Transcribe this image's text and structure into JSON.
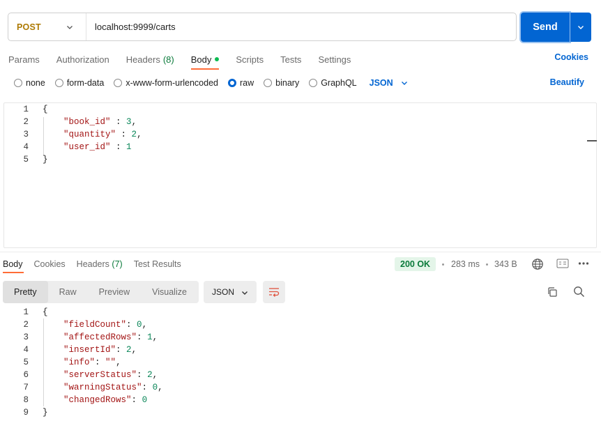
{
  "request": {
    "method": "POST",
    "url": "localhost:9999/carts",
    "send_label": "Send"
  },
  "request_tabs": [
    {
      "label": "Params"
    },
    {
      "label": "Authorization"
    },
    {
      "label": "Headers",
      "count": "(8)"
    },
    {
      "label": "Body"
    },
    {
      "label": "Scripts"
    },
    {
      "label": "Tests"
    },
    {
      "label": "Settings"
    }
  ],
  "cookies_label": "Cookies",
  "body_types": [
    "none",
    "form-data",
    "x-www-form-urlencoded",
    "raw",
    "binary",
    "GraphQL"
  ],
  "body_format": "JSON",
  "beautify_label": "Beautify",
  "request_body": {
    "line_numbers": [
      "1",
      "2",
      "3",
      "4",
      "5"
    ],
    "open": "{",
    "close": "}",
    "k1": "\"book_id\"",
    "s1": " : ",
    "v1": "3",
    "c1": ",",
    "k2": "\"quantity\"",
    "s2": " : ",
    "v2": "2",
    "c2": ",",
    "k3": "\"user_id\"",
    "s3": " : ",
    "v3": "1"
  },
  "response": {
    "tabs": [
      {
        "label": "Body"
      },
      {
        "label": "Cookies"
      },
      {
        "label": "Headers",
        "count": "(7)"
      },
      {
        "label": "Test Results"
      }
    ],
    "status": "200 OK",
    "time": "283 ms",
    "size": "343 B",
    "views": [
      "Pretty",
      "Raw",
      "Preview",
      "Visualize"
    ],
    "format": "JSON",
    "line_numbers": [
      "1",
      "2",
      "3",
      "4",
      "5",
      "6",
      "7",
      "8",
      "9"
    ],
    "open": "{",
    "close": "}",
    "k1": "\"fieldCount\"",
    "v1": "0",
    "k2": "\"affectedRows\"",
    "v2": "1",
    "k3": "\"insertId\"",
    "v3": "2",
    "k4": "\"info\"",
    "v4": "\"\"",
    "k5": "\"serverStatus\"",
    "v5": "2",
    "k6": "\"warningStatus\"",
    "v6": "0",
    "k7": "\"changedRows\"",
    "v7": "0",
    "sep": ": ",
    "comma": ","
  },
  "colors": {
    "accent": "#0265d2",
    "method": "#ad7a03",
    "active_tab": "#ff6c37",
    "status_ok": "#0a7a3a"
  }
}
